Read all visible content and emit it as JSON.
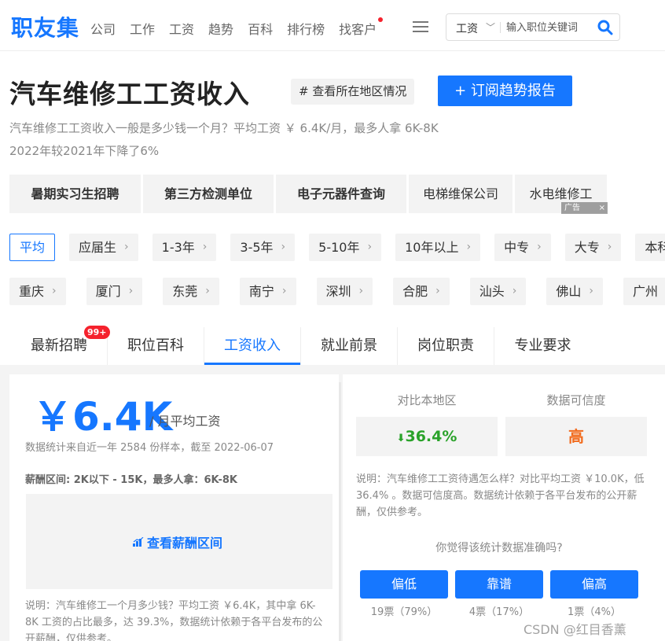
{
  "header": {
    "logo": "职友集",
    "nav": [
      "公司",
      "工作",
      "工资",
      "趋势",
      "百科",
      "排行榜",
      "找客户"
    ],
    "search_type": "工资",
    "search_placeholder": "输入职位关键词"
  },
  "page": {
    "title": "汽车维修工工资收入",
    "region_button": "# 查看所在地区情况",
    "subscribe_button": "+ 订阅趋势报告",
    "desc_line1": "汽车维修工工资收入一般是多少钱一个月？平均工资 ￥ 6.4K/月，最多人拿 6K-8K",
    "desc_line2": "2022年较2021年下降了6%"
  },
  "ads": {
    "items": [
      "暑期实习生招聘",
      "第三方检测单位",
      "电子元器件查询",
      "电梯维保公司",
      "水电维修工"
    ],
    "badge": "广告",
    "close": "×"
  },
  "filters": {
    "experience": [
      "平均",
      "应届生",
      "1-3年",
      "3-5年",
      "5-10年",
      "10年以上",
      "中专",
      "大专",
      "本科"
    ],
    "cities": [
      "重庆",
      "厦门",
      "东莞",
      "南宁",
      "深圳",
      "合肥",
      "汕头",
      "佛山",
      "广州"
    ]
  },
  "tabs": {
    "items": [
      "最新招聘",
      "职位百科",
      "工资收入",
      "就业前景",
      "岗位职责",
      "专业要求"
    ],
    "badge": "99+",
    "active_index": 2
  },
  "salary": {
    "value": "￥6.4K",
    "unit": "/ 月平均工资",
    "note": "数据统计来自近一年 2584 份样本，截至 2022-06-07",
    "range": "薪酬区间: 2K以下 - 15K，最多人拿：6K-8K",
    "range_link": "查看薪酬区间",
    "explain": "说明：汽车维修工一个月多少钱？平均工资 ￥6.4K，其中拿 6K-8K 工资的占比最多，达 39.3%，数据统计依赖于各平台发布的公开薪酬，仅供参考。"
  },
  "compare": {
    "head1": "对比本地区",
    "head2": "数据可信度",
    "value1": "36.4%",
    "value2": "高",
    "note": "说明：汽车维修工工资待遇怎么样？对比平均工资 ￥10.0K，低 36.4% 。数据可信度高。数据统计依赖于各平台发布的公开薪酬，仅供参考。",
    "question": "你觉得该统计数据准确吗?",
    "votes": [
      {
        "label": "偏低",
        "count": "19票（79%）"
      },
      {
        "label": "靠谱",
        "count": "4票（17%）"
      },
      {
        "label": "偏高",
        "count": "1票（4%）"
      }
    ],
    "colors": {
      "down": "#2aa22a",
      "high": "#f26b1d"
    }
  },
  "watermark": "CSDN @红目香薰",
  "theme": {
    "accent": "#1677ff"
  }
}
